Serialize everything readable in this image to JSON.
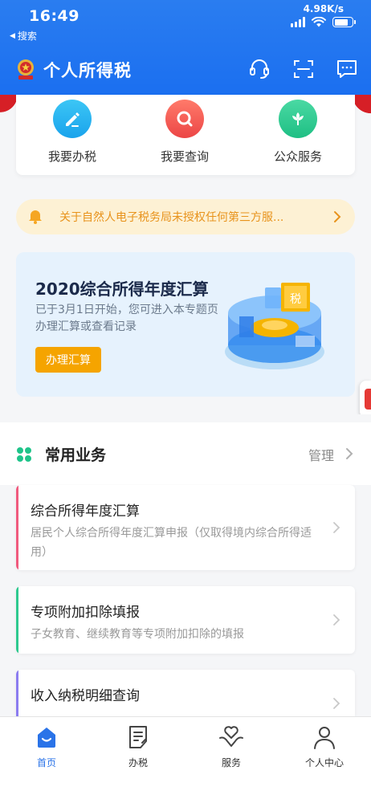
{
  "status_bar": {
    "time": "16:49",
    "back_label": "搜索",
    "network_speed": "4.98K/s"
  },
  "header": {
    "title": "个人所得税",
    "icons": [
      "emblem-icon",
      "customer-service-icon",
      "scan-icon",
      "message-icon"
    ]
  },
  "quick_actions": [
    {
      "label": "我要办税",
      "icon": "edit-icon",
      "color": "#20b4f0"
    },
    {
      "label": "我要查询",
      "icon": "search-icon",
      "color": "#f05a5a"
    },
    {
      "label": "公众服务",
      "icon": "flower-icon",
      "color": "#2ec98f"
    }
  ],
  "notice": {
    "text": "关于自然人电子税务局未授权任何第三方服...",
    "color": "#e8931c"
  },
  "annual_card": {
    "title": "2020综合所得年度汇算",
    "description": "已于3月1日开始，您可进入本专题页办理汇算或查看记录",
    "button": "办理汇算",
    "art_badge": "税"
  },
  "common_business": {
    "title": "常用业务",
    "manage_label": "管理",
    "items": [
      {
        "title": "综合所得年度汇算",
        "desc": "居民个人综合所得年度汇算申报（仅取得境内综合所得适用）",
        "accent": "#f05a7e"
      },
      {
        "title": "专项附加扣除填报",
        "desc": "子女教育、继续教育等专项附加扣除的填报",
        "accent": "#2ec98f"
      },
      {
        "title": "收入纳税明细查询",
        "desc": "",
        "accent": "#8b7cf0"
      }
    ]
  },
  "tabbar": {
    "tabs": [
      {
        "label": "首页",
        "icon": "home-icon",
        "active": true
      },
      {
        "label": "办税",
        "icon": "document-icon",
        "active": false
      },
      {
        "label": "服务",
        "icon": "heart-hands-icon",
        "active": false
      },
      {
        "label": "个人中心",
        "icon": "user-icon",
        "active": false
      }
    ]
  }
}
